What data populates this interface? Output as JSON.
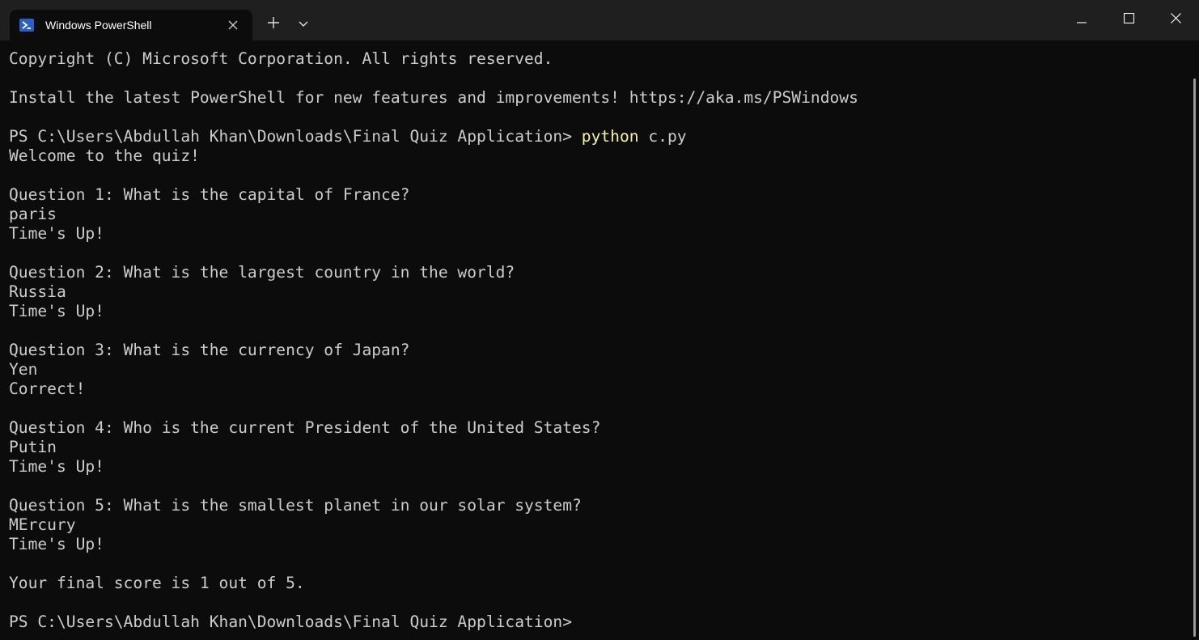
{
  "window": {
    "tab_title": "Windows PowerShell",
    "tab_icon": "powershell-icon",
    "new_tab_icon": "plus-icon",
    "dropdown_icon": "chevron-down-icon",
    "minimize_icon": "minimize-icon",
    "maximize_icon": "maximize-icon",
    "close_icon": "close-icon"
  },
  "colors": {
    "background": "#0c0c0c",
    "titlebar": "#1f1f1f",
    "text": "#cccccc",
    "command_highlight": "#f9f1a5",
    "tab_icon_bg": "#2b5fc1"
  },
  "terminal": {
    "lines": [
      "Copyright (C) Microsoft Corporation. All rights reserved.",
      "",
      "Install the latest PowerShell for new features and improvements! https://aka.ms/PSWindows",
      "",
      "",
      "Welcome to the quiz!",
      "",
      "Question 1: What is the capital of France?",
      "paris",
      "Time's Up!",
      "",
      "Question 2: What is the largest country in the world?",
      "Russia",
      "Time's Up!",
      "",
      "Question 3: What is the currency of Japan?",
      "Yen",
      "Correct!",
      "",
      "Question 4: Who is the current President of the United States?",
      "Putin",
      "Time's Up!",
      "",
      "Question 5: What is the smallest planet in our solar system?",
      "MErcury",
      "Time's Up!",
      "",
      "Your final score is 1 out of 5.",
      "",
      "PS C:\\Users\\Abdullah Khan\\Downloads\\Final Quiz Application>"
    ],
    "command_line": {
      "prompt": "PS C:\\Users\\Abdullah Khan\\Downloads\\Final Quiz Application> ",
      "command": "python",
      "args": " c.py"
    }
  }
}
